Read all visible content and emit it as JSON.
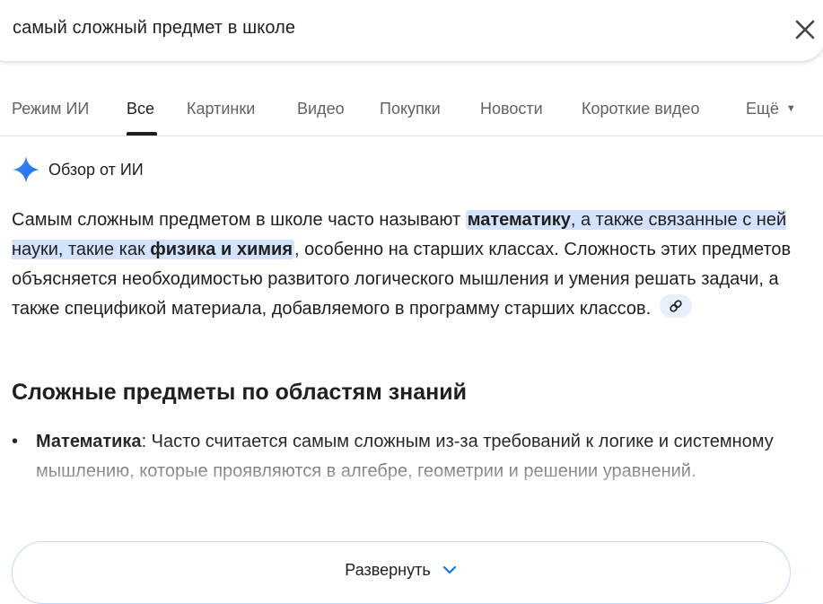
{
  "search": {
    "query": "самый сложный предмет в школе"
  },
  "tabs": [
    {
      "label": "Режим ИИ"
    },
    {
      "label": "Все",
      "active": true
    },
    {
      "label": "Картинки"
    },
    {
      "label": "Видео"
    },
    {
      "label": "Покупки"
    },
    {
      "label": "Новости"
    },
    {
      "label": "Короткие видео"
    },
    {
      "label": "Ещё"
    }
  ],
  "ai_overview": {
    "title": "Обзор от ИИ",
    "answer": {
      "intro": "Самым сложным предметом в школе часто называют",
      "hl_bold_1": "математику",
      "hl_mid": ", а также связанные с ней науки, такие как",
      "hl_bold_2": "физика и химия",
      "rest": ", особенно на старших классах. Сложность этих предметов объясняется необходимостью развитого логического мышления и умения решать задачи, а также спецификой материала, добавляемого в программу старших классов."
    },
    "section_title": "Сложные предметы по областям знаний",
    "bullets": [
      {
        "term": "Математика",
        "text": ": Часто считается самым сложным из-за требований к логике и системному мышлению, которые проявляются в алгебре, геометрии и решении уравнений."
      }
    ],
    "expand_label": "Развернуть"
  },
  "colors": {
    "highlight": "#d3e3fd",
    "link_chip": "#e8f0fe",
    "ai_star": "#4285f4",
    "text": "#1f1f1f",
    "muted": "#5f6368"
  },
  "icons": [
    "close-icon",
    "ai-sparkle-icon",
    "link-icon",
    "chevron-down-icon",
    "caret-down-icon"
  ]
}
